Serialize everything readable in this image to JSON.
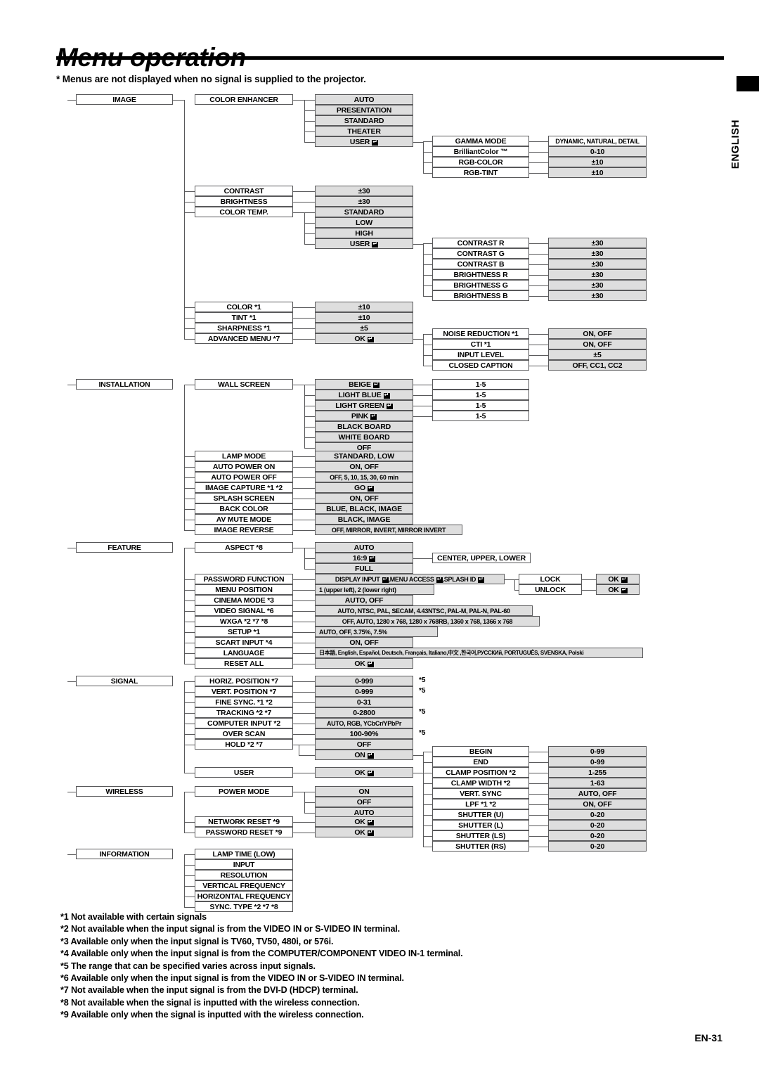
{
  "page": {
    "title": "Menu operation",
    "top_note": "* Menus are not displayed when no signal is supplied to the projector.",
    "side_tab": "ENGLISH",
    "page_number": "EN-31"
  },
  "menu_tree": {
    "image": {
      "root": "IMAGE",
      "color_enhancer": {
        "label": "COLOR ENHANCER",
        "options": [
          "AUTO",
          "PRESENTATION",
          "STANDARD",
          "THEATER",
          "USER"
        ],
        "user_sub": [
          {
            "label": "GAMMA MODE",
            "value": "DYNAMIC, NATURAL, DETAIL"
          },
          {
            "label": "BrilliantColor ™",
            "value": "0-10"
          },
          {
            "label": "RGB-COLOR",
            "value": "±10"
          },
          {
            "label": "RGB-TINT",
            "value": "±10"
          }
        ]
      },
      "items": [
        {
          "label": "CONTRAST",
          "value": "±30"
        },
        {
          "label": "BRIGHTNESS",
          "value": "±30"
        },
        {
          "label": "COLOR TEMP.",
          "value": "STANDARD"
        }
      ],
      "color_temp_options": [
        "STANDARD",
        "LOW",
        "HIGH",
        "USER"
      ],
      "color_temp_user_sub": [
        {
          "label": "CONTRAST R",
          "value": "±30"
        },
        {
          "label": "CONTRAST G",
          "value": "±30"
        },
        {
          "label": "CONTRAST B",
          "value": "±30"
        },
        {
          "label": "BRIGHTNESS R",
          "value": "±30"
        },
        {
          "label": "BRIGHTNESS G",
          "value": "±30"
        },
        {
          "label": "BRIGHTNESS B",
          "value": "±30"
        }
      ],
      "items2": [
        {
          "label": "COLOR *1",
          "value": "±10"
        },
        {
          "label": "TINT *1",
          "value": "±10"
        },
        {
          "label": "SHARPNESS *1",
          "value": "±5"
        },
        {
          "label": "ADVANCED MENU *7",
          "value": "OK"
        }
      ],
      "advanced_sub": [
        {
          "label": "NOISE REDUCTION *1",
          "value": "ON, OFF"
        },
        {
          "label": "CTI *1",
          "value": "ON, OFF"
        },
        {
          "label": "INPUT LEVEL",
          "value": "±5"
        },
        {
          "label": "CLOSED CAPTION",
          "value": "OFF, CC1, CC2"
        }
      ]
    },
    "installation": {
      "root": "INSTALLATION",
      "wall_screen": {
        "label": "WALL SCREEN",
        "options": [
          "BEIGE",
          "LIGHT BLUE",
          "LIGHT GREEN",
          "PINK",
          "BLACK BOARD",
          "WHITE BOARD",
          "OFF"
        ],
        "levels": [
          "1-5",
          "1-5",
          "1-5",
          "1-5"
        ]
      },
      "items": [
        {
          "label": "LAMP MODE",
          "value": "STANDARD, LOW"
        },
        {
          "label": "AUTO POWER ON",
          "value": "ON, OFF"
        },
        {
          "label": "AUTO POWER OFF",
          "value": "OFF, 5, 10, 15, 30, 60 min"
        },
        {
          "label": "IMAGE CAPTURE *1 *2",
          "value": "GO"
        },
        {
          "label": "SPLASH SCREEN",
          "value": "ON, OFF"
        },
        {
          "label": "BACK COLOR",
          "value": "BLUE, BLACK, IMAGE"
        },
        {
          "label": "AV MUTE MODE",
          "value": "BLACK, IMAGE"
        },
        {
          "label": "IMAGE REVERSE",
          "value": "OFF, MIRROR, INVERT, MIRROR INVERT"
        }
      ]
    },
    "feature": {
      "root": "FEATURE",
      "aspect": {
        "label": "ASPECT *8",
        "options": [
          "AUTO",
          "16:9",
          "FULL"
        ],
        "sub_169": "CENTER, UPPER, LOWER"
      },
      "items": [
        {
          "label": "PASSWORD FUNCTION",
          "value": "DISPLAY INPUT , MENU ACCESS , SPLASH ID"
        },
        {
          "label": "MENU POSITION",
          "value": "1 (upper left),  2 (lower right)"
        },
        {
          "label": "CINEMA MODE *3",
          "value": "AUTO, OFF"
        },
        {
          "label": "VIDEO SIGNAL *6",
          "value": "AUTO, NTSC, PAL, SECAM, 4.43NTSC, PAL-M, PAL-N, PAL-60"
        },
        {
          "label": "WXGA *2 *7 *8",
          "value": "OFF, AUTO, 1280 x 768, 1280 x 768RB, 1360 x 768, 1366 x 768"
        },
        {
          "label": "SETUP *1",
          "value": "AUTO, OFF, 3.75%, 7.5%"
        },
        {
          "label": "SCART INPUT *4",
          "value": "ON, OFF"
        },
        {
          "label": "LANGUAGE",
          "value": "日本語, English, Español, Deutsch, Français, Italiano,中文 ,한국어,РУССКИй, PORTUGUÊS, SVENSKA, Polski"
        },
        {
          "label": "RESET ALL",
          "value": "OK"
        }
      ],
      "password_lock": [
        {
          "label": "LOCK",
          "value": "OK"
        },
        {
          "label": "UNLOCK",
          "value": "OK"
        }
      ]
    },
    "signal": {
      "root": "SIGNAL",
      "items": [
        {
          "label": "HORIZ. POSITION *7",
          "value": "0-999",
          "note": "*5"
        },
        {
          "label": "VERT. POSITION *7",
          "value": "0-999",
          "note": "*5"
        },
        {
          "label": "FINE SYNC. *1 *2",
          "value": "0-31",
          "note": ""
        },
        {
          "label": "TRACKING *2 *7",
          "value": "0-2800",
          "note": "*5"
        },
        {
          "label": "COMPUTER INPUT *2",
          "value": "AUTO, RGB, YCbCr/YPbPr",
          "note": ""
        },
        {
          "label": "OVER SCAN",
          "value": "100-90%",
          "note": "*5"
        },
        {
          "label": "HOLD *2 *7",
          "value": "OFF",
          "note": ""
        }
      ],
      "hold_on": "ON",
      "user": {
        "label": "USER",
        "value": "OK"
      },
      "sub": [
        {
          "label": "BEGIN",
          "value": "0-99"
        },
        {
          "label": "END",
          "value": "0-99"
        },
        {
          "label": "CLAMP POSITION *2",
          "value": "1-255"
        },
        {
          "label": "CLAMP WIDTH *2",
          "value": "1-63"
        },
        {
          "label": "VERT. SYNC",
          "value": "AUTO, OFF"
        },
        {
          "label": "LPF *1 *2",
          "value": "ON, OFF"
        },
        {
          "label": "SHUTTER (U)",
          "value": "0-20"
        },
        {
          "label": "SHUTTER (L)",
          "value": "0-20"
        },
        {
          "label": "SHUTTER (LS)",
          "value": "0-20"
        },
        {
          "label": "SHUTTER (RS)",
          "value": "0-20"
        }
      ]
    },
    "wireless": {
      "root": "WIRELESS",
      "power_mode": {
        "label": "POWER MODE",
        "options": [
          "ON",
          "OFF",
          "AUTO"
        ]
      },
      "items": [
        {
          "label": "NETWORK RESET *9",
          "value": "OK"
        },
        {
          "label": "PASSWORD RESET *9",
          "value": "OK"
        }
      ]
    },
    "information": {
      "root": "INFORMATION",
      "items": [
        "LAMP TIME (LOW)",
        "INPUT",
        "RESOLUTION",
        "VERTICAL FREQUENCY",
        "HORIZONTAL FREQUENCY",
        "SYNC. TYPE *2 *7 *8"
      ]
    }
  },
  "footnotes": [
    "*1 Not available with certain signals",
    "*2 Not available when the input signal is from the VIDEO IN or S-VIDEO IN terminal.",
    "*3 Available only when the input signal is TV60, TV50, 480i, or 576i.",
    "*4 Available only when the input signal is from the COMPUTER/COMPONENT VIDEO IN-1 terminal.",
    "*5 The range that can be specified varies across input signals.",
    "*6 Available only when the input signal is from the VIDEO IN or S-VIDEO IN terminal.",
    "*7 Not available when the input signal is from the DVI-D (HDCP) terminal.",
    "*8 Not available when the signal is inputted with the wireless connection.",
    "*9 Available only when the signal is inputted with the wireless connection."
  ]
}
